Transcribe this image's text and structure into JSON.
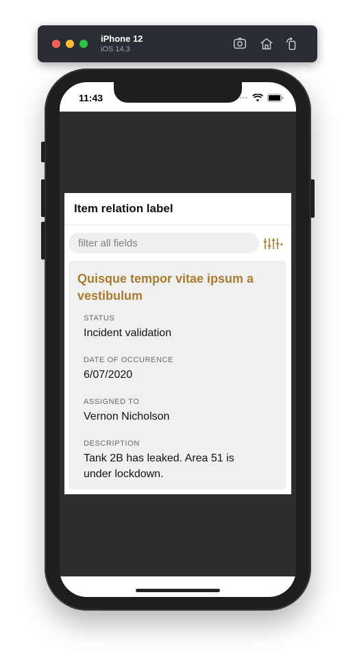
{
  "simulator": {
    "device_name": "iPhone 12",
    "os_version": "iOS 14.3",
    "icons": [
      "screenshot-icon",
      "home-icon",
      "rotate-icon"
    ]
  },
  "status_bar": {
    "time": "11:43"
  },
  "panel": {
    "title": "Item relation label",
    "filter": {
      "placeholder": "filter all fields",
      "value": ""
    }
  },
  "item": {
    "title": "Quisque tempor vitae ipsum a vestibulum",
    "fields": [
      {
        "label": "STATUS",
        "value": "Incident validation"
      },
      {
        "label": "DATE OF OCCURENCE",
        "value": "6/07/2020"
      },
      {
        "label": "ASSIGNED TO",
        "value": "Vernon Nicholson"
      },
      {
        "label": "DESCRIPTION",
        "value": "Tank 2B has leaked. Area 51 is under lockdown."
      }
    ]
  },
  "colors": {
    "accent": "#a87b2f",
    "sim_bar": "#2b2d35",
    "screen_bg": "#2e2e2e",
    "card_bg": "#f0f0f0"
  }
}
